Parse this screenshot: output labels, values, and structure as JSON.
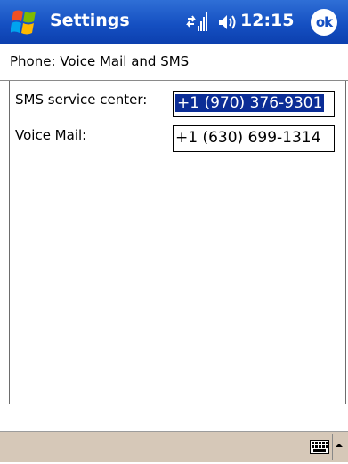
{
  "titlebar": {
    "app_title": "Settings",
    "time": "12:15",
    "ok_label": "ok",
    "accent_color": "#1550c2",
    "icons": [
      "start-menu-logo",
      "connectivity-icon",
      "speaker-icon",
      "ok-icon"
    ]
  },
  "page": {
    "title": "Phone: Voice Mail and SMS"
  },
  "fields": {
    "sms_label": "SMS service center:",
    "sms_value": "+1 (970) 376-9301",
    "voicemail_label": "Voice Mail:",
    "voicemail_value": "+1 (630) 699-1314"
  },
  "menubar": {
    "icons": [
      "keyboard-icon",
      "sip-arrow-up-icon"
    ]
  }
}
